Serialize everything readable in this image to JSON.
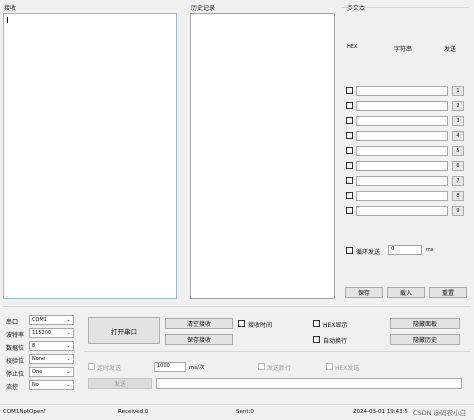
{
  "receive": {
    "title": "接收"
  },
  "history": {
    "title": "历史记录"
  },
  "multi": {
    "title": "多文本",
    "hdr_hex": "HEX",
    "hdr_str": "字符串",
    "hdr_send": "发送",
    "rows": [
      {
        "n": "1"
      },
      {
        "n": "2"
      },
      {
        "n": "3"
      },
      {
        "n": "4"
      },
      {
        "n": "5"
      },
      {
        "n": "6"
      },
      {
        "n": "7"
      },
      {
        "n": "8"
      },
      {
        "n": "9"
      }
    ],
    "loop_send": "循环发送",
    "loop_value": "0",
    "loop_unit": "ms",
    "save": "保存",
    "load": "载入",
    "reset": "重置"
  },
  "serial": {
    "port_label": "串口",
    "port_value": "COM1",
    "baud_label": "波特率",
    "baud_value": "115200",
    "data_label": "数据位",
    "data_value": "8",
    "parity_label": "校验位",
    "parity_value": "None",
    "stop_label": "停止位",
    "stop_value": "One",
    "flow_label": "流控",
    "flow_value": "No"
  },
  "controls": {
    "open_port": "打开串口",
    "clear_recv": "清空接收",
    "save_recv": "保存接收",
    "recv_time": "接收时间",
    "hex_display": "HEX显示",
    "auto_wrap": "自动换行",
    "hide_panel": "隐藏面板",
    "hide_history": "隐藏历史"
  },
  "send": {
    "timed_send": "定时发送",
    "interval_value": "1000",
    "interval_unit": "ms/次",
    "send_newline": "发送新行",
    "hex_send": "HEX发送",
    "send_button": "发送"
  },
  "status": {
    "port_state": "COM1NotOpen!",
    "received": "Received:0",
    "sent": "Sent:0",
    "datetime": "2024-03-01  19:43:5",
    "watermark": "CSDN @码农小白"
  },
  "colors": {
    "window_bg": "#f0f0f0",
    "textbox_border": "#9eb6d3",
    "button_bg": "#e3e3e3"
  }
}
